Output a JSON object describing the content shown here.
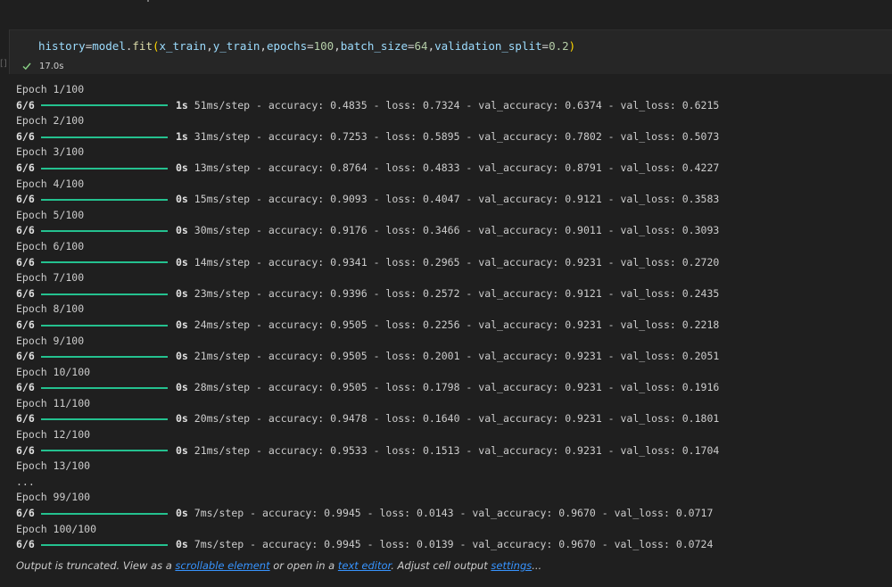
{
  "cell": {
    "code_tokens": [
      {
        "t": "history",
        "c": "tok-var"
      },
      {
        "t": "=",
        "c": "tok-op"
      },
      {
        "t": "model",
        "c": "tok-var"
      },
      {
        "t": ".",
        "c": "tok-op"
      },
      {
        "t": "fit",
        "c": "tok-fn"
      },
      {
        "t": "(",
        "c": "tok-paren"
      },
      {
        "t": "x_train",
        "c": "tok-var"
      },
      {
        "t": ",",
        "c": "tok-op"
      },
      {
        "t": "y_train",
        "c": "tok-var"
      },
      {
        "t": ",",
        "c": "tok-op"
      },
      {
        "t": "epochs",
        "c": "tok-var"
      },
      {
        "t": "=",
        "c": "tok-op"
      },
      {
        "t": "100",
        "c": "tok-num"
      },
      {
        "t": ",",
        "c": "tok-op"
      },
      {
        "t": "batch_size",
        "c": "tok-var"
      },
      {
        "t": "=",
        "c": "tok-op"
      },
      {
        "t": "64",
        "c": "tok-num"
      },
      {
        "t": ",",
        "c": "tok-op"
      },
      {
        "t": "validation_split",
        "c": "tok-var"
      },
      {
        "t": "=",
        "c": "tok-op"
      },
      {
        "t": "0.2",
        "c": "tok-num"
      },
      {
        "t": ")",
        "c": "tok-paren"
      }
    ],
    "exec_time": "17.0s",
    "marker": "[]"
  },
  "output": {
    "lines": [
      {
        "type": "epoch",
        "text": "Epoch 1/100"
      },
      {
        "type": "step",
        "steps": "6/6",
        "time": "1s",
        "rest": " 51ms/step - accuracy: 0.4835 - loss: 0.7324 - val_accuracy: 0.6374 - val_loss: 0.6215"
      },
      {
        "type": "epoch",
        "text": "Epoch 2/100"
      },
      {
        "type": "step",
        "steps": "6/6",
        "time": "1s",
        "rest": " 31ms/step - accuracy: 0.7253 - loss: 0.5895 - val_accuracy: 0.7802 - val_loss: 0.5073"
      },
      {
        "type": "epoch",
        "text": "Epoch 3/100"
      },
      {
        "type": "step",
        "steps": "6/6",
        "time": "0s",
        "rest": " 13ms/step - accuracy: 0.8764 - loss: 0.4833 - val_accuracy: 0.8791 - val_loss: 0.4227"
      },
      {
        "type": "epoch",
        "text": "Epoch 4/100"
      },
      {
        "type": "step",
        "steps": "6/6",
        "time": "0s",
        "rest": " 15ms/step - accuracy: 0.9093 - loss: 0.4047 - val_accuracy: 0.9121 - val_loss: 0.3583"
      },
      {
        "type": "epoch",
        "text": "Epoch 5/100"
      },
      {
        "type": "step",
        "steps": "6/6",
        "time": "0s",
        "rest": " 30ms/step - accuracy: 0.9176 - loss: 0.3466 - val_accuracy: 0.9011 - val_loss: 0.3093"
      },
      {
        "type": "epoch",
        "text": "Epoch 6/100"
      },
      {
        "type": "step",
        "steps": "6/6",
        "time": "0s",
        "rest": " 14ms/step - accuracy: 0.9341 - loss: 0.2965 - val_accuracy: 0.9231 - val_loss: 0.2720"
      },
      {
        "type": "epoch",
        "text": "Epoch 7/100"
      },
      {
        "type": "step",
        "steps": "6/6",
        "time": "0s",
        "rest": " 23ms/step - accuracy: 0.9396 - loss: 0.2572 - val_accuracy: 0.9121 - val_loss: 0.2435"
      },
      {
        "type": "epoch",
        "text": "Epoch 8/100"
      },
      {
        "type": "step",
        "steps": "6/6",
        "time": "0s",
        "rest": " 24ms/step - accuracy: 0.9505 - loss: 0.2256 - val_accuracy: 0.9231 - val_loss: 0.2218"
      },
      {
        "type": "epoch",
        "text": "Epoch 9/100"
      },
      {
        "type": "step",
        "steps": "6/6",
        "time": "0s",
        "rest": " 21ms/step - accuracy: 0.9505 - loss: 0.2001 - val_accuracy: 0.9231 - val_loss: 0.2051"
      },
      {
        "type": "epoch",
        "text": "Epoch 10/100"
      },
      {
        "type": "step",
        "steps": "6/6",
        "time": "0s",
        "rest": " 28ms/step - accuracy: 0.9505 - loss: 0.1798 - val_accuracy: 0.9231 - val_loss: 0.1916"
      },
      {
        "type": "epoch",
        "text": "Epoch 11/100"
      },
      {
        "type": "step",
        "steps": "6/6",
        "time": "0s",
        "rest": " 20ms/step - accuracy: 0.9478 - loss: 0.1640 - val_accuracy: 0.9231 - val_loss: 0.1801"
      },
      {
        "type": "epoch",
        "text": "Epoch 12/100"
      },
      {
        "type": "step",
        "steps": "6/6",
        "time": "0s",
        "rest": " 21ms/step - accuracy: 0.9533 - loss: 0.1513 - val_accuracy: 0.9231 - val_loss: 0.1704"
      },
      {
        "type": "epoch",
        "text": "Epoch 13/100"
      },
      {
        "type": "epoch",
        "text": "..."
      },
      {
        "type": "epoch",
        "text": "Epoch 99/100"
      },
      {
        "type": "step",
        "steps": "6/6",
        "time": "0s",
        "rest": " 7ms/step - accuracy: 0.9945 - loss: 0.0143 - val_accuracy: 0.9670 - val_loss: 0.0717"
      },
      {
        "type": "epoch",
        "text": "Epoch 100/100"
      },
      {
        "type": "step",
        "steps": "6/6",
        "time": "0s",
        "rest": " 7ms/step - accuracy: 0.9945 - loss: 0.0139 - val_accuracy: 0.9670 - val_loss: 0.0724"
      }
    ]
  },
  "footer": {
    "text1": "Output is truncated. View as a ",
    "link1": "scrollable element",
    "text2": " or open in a ",
    "link2": "text editor",
    "text3": ". Adjust cell output ",
    "link3": "settings",
    "text4": "..."
  },
  "colors": {
    "background": "#1f1f1f",
    "progress_bar": "#24c18f",
    "link": "#3794ff"
  },
  "icons": {
    "status": "check-icon"
  }
}
